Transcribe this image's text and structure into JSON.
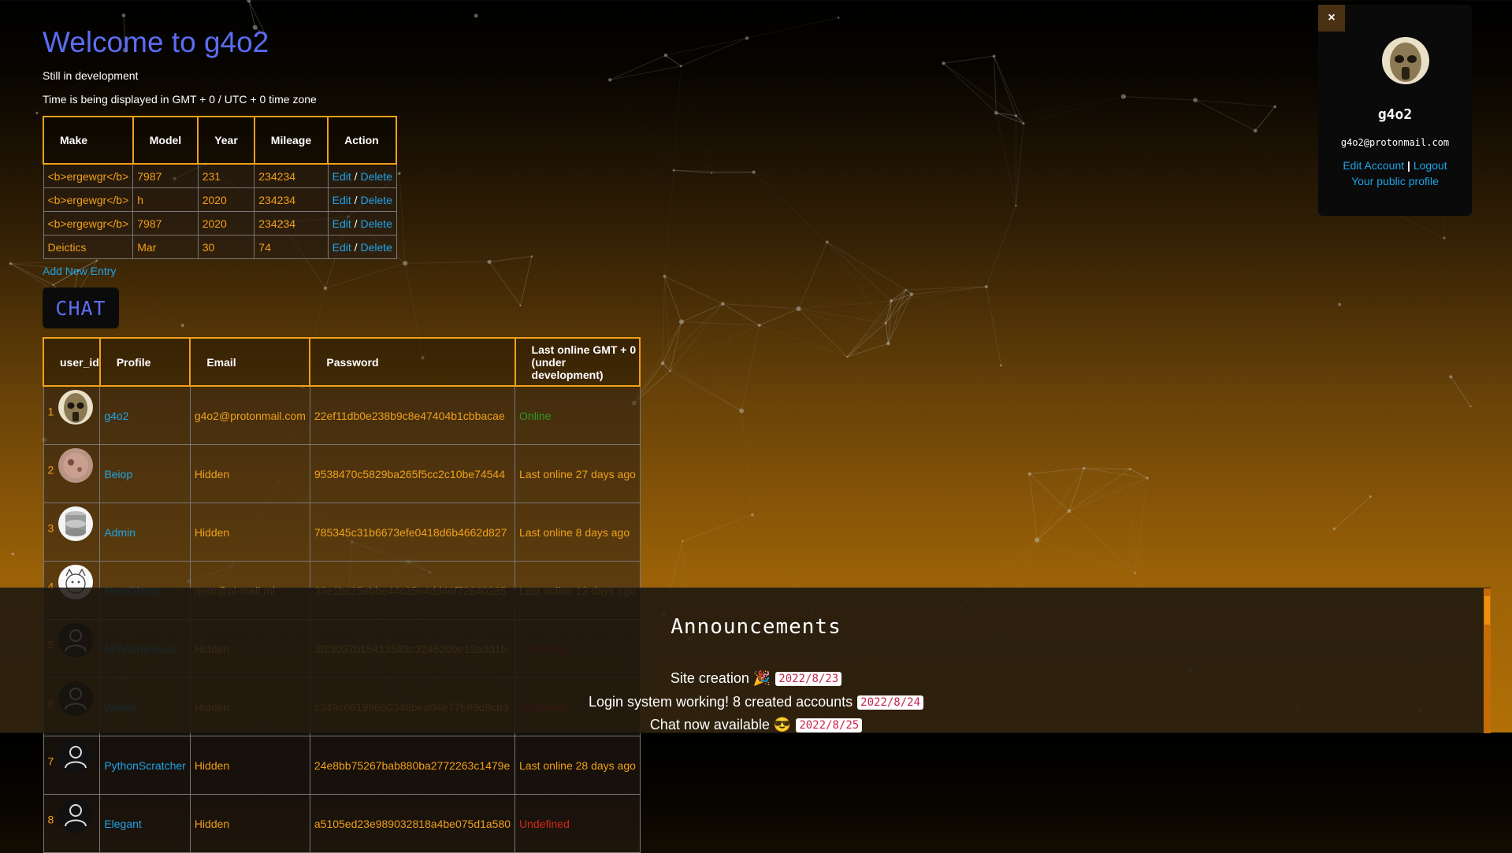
{
  "header": {
    "title": "Welcome to g4o2",
    "subtitle": "Still in development",
    "timezone_note": "Time is being displayed in GMT + 0 / UTC + 0 time zone"
  },
  "cars_table": {
    "columns": [
      "Make",
      "Model",
      "Year",
      "Mileage",
      "Action"
    ],
    "rows": [
      {
        "make": "<b>ergewgr</b>",
        "model": "7987",
        "year": "231",
        "mileage": "234234"
      },
      {
        "make": "<b>ergewgr</b>",
        "model": "h",
        "year": "2020",
        "mileage": "234234"
      },
      {
        "make": "<b>ergewgr</b>",
        "model": "7987",
        "year": "2020",
        "mileage": "234234"
      },
      {
        "make": "Deictics",
        "model": "Mar",
        "year": "30",
        "mileage": "74"
      }
    ],
    "edit_label": "Edit",
    "separator": "/",
    "delete_label": "Delete",
    "add_new_label": "Add New Entry"
  },
  "chat_button_label": "CHAT",
  "users_table": {
    "columns": [
      "user_id",
      "Profile",
      "Email",
      "Password",
      "Last online GMT + 0 (under development)"
    ],
    "rows": [
      {
        "id": "1",
        "avatar": "gasmask-avatar-icon",
        "profile": "g4o2",
        "email": "g4o2@protonmail.com",
        "password": "22ef11db0e238b9c8e47404b1cbbacae",
        "status": "Online",
        "status_kind": "online"
      },
      {
        "id": "2",
        "avatar": "blob-avatar-icon",
        "profile": "Beiop",
        "email": "Hidden",
        "password": "9538470c5829ba265f5cc2c10be74544",
        "status": "Last online 27 days ago",
        "status_kind": "last"
      },
      {
        "id": "3",
        "avatar": "database-avatar-icon",
        "profile": "Admin",
        "email": "Hidden",
        "password": "785345c31b6673efe0418d6b4662d827",
        "status": "Last online 8 days ago",
        "status_kind": "last"
      },
      {
        "id": "4",
        "avatar": "sketch-cat-avatar-icon",
        "profile": "NeroGizmo",
        "email": "nero@pi-mail.ml",
        "password": "33e1bc25ebbe44c35e4dd46f72640285",
        "status": "Last online 13 days ago",
        "status_kind": "last"
      },
      {
        "id": "5",
        "avatar": "default-user-icon",
        "profile": "MrAnonymous",
        "email": "Hidden",
        "password": "3f23037b15413583c3245209e12a3d1b",
        "status": "Undefined",
        "status_kind": "undef"
      },
      {
        "id": "6",
        "avatar": "default-user-icon",
        "profile": "Wallee",
        "email": "Hidden",
        "password": "c349c661996b0346bea04e77b89d9cb3",
        "status": "Undefined",
        "status_kind": "undef"
      },
      {
        "id": "7",
        "avatar": "default-user-icon",
        "profile": "PythonScratcher",
        "email": "Hidden",
        "password": "24e8bb75267bab880ba2772263c1479e",
        "status": "Last online 28 days ago",
        "status_kind": "last"
      },
      {
        "id": "8",
        "avatar": "default-user-icon",
        "profile": "Elegant",
        "email": "Hidden",
        "password": "a5105ed23e989032818a4be075d1a580",
        "status": "Undefined",
        "status_kind": "undef"
      }
    ]
  },
  "profile_panel": {
    "close_label": "×",
    "username": "g4o2",
    "email": "g4o2@protonmail.com",
    "edit_account_label": "Edit Account",
    "divider": "|",
    "logout_label": "Logout",
    "public_profile_label": "Your public profile"
  },
  "announcements": {
    "title": "Announcements",
    "items": [
      {
        "text": "Site creation 🎉",
        "date": "2022/8/23"
      },
      {
        "text": "Login system working! 8 created accounts",
        "date": "2022/8/24"
      },
      {
        "text": "Chat now available 😎",
        "date": "2022/8/25"
      }
    ]
  },
  "colors": {
    "accent_orange": "#f0a01a",
    "link_blue": "#1ea4e8",
    "title_blue": "#5b6df0",
    "online_green": "#2a9a2a",
    "undefined_red": "#d8261a"
  }
}
